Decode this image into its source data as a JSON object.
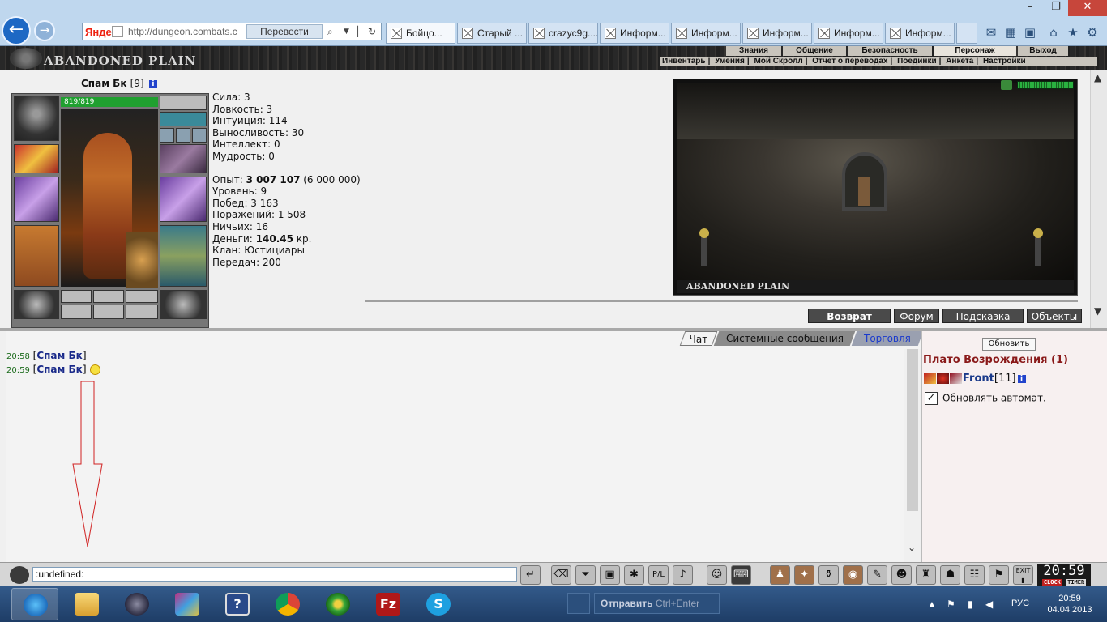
{
  "browser": {
    "search_engine": "Яндекс",
    "url": "http://dungeon.combats.c",
    "translate_label": "Перевести",
    "tabs": [
      {
        "label": "Бойцо..."
      },
      {
        "label": "Старый ..."
      },
      {
        "label": "crazyc9g...."
      },
      {
        "label": "Информ..."
      },
      {
        "label": "Информ..."
      },
      {
        "label": "Информ..."
      },
      {
        "label": "Информ..."
      },
      {
        "label": "Информ..."
      }
    ],
    "window_controls": {
      "minimize": "–",
      "restore": "❐",
      "close": "✕"
    }
  },
  "game": {
    "logo": "ABANDONED PLAIN",
    "top_menu": [
      "Знания",
      "Общение",
      "Безопасность",
      "Персонаж",
      "Выход"
    ],
    "sub_menu": [
      "Инвентарь",
      "Умения",
      "Мой Скролл",
      "Отчет о переводах",
      "Поединки",
      "Анкета",
      "Настройки"
    ]
  },
  "character": {
    "name": "Спам Бк",
    "level": "[9]",
    "hp": "819/819",
    "hp_fraction": 1.0,
    "stats": {
      "strength": "Сила: 3",
      "agility": "Ловкость: 3",
      "intuition": "Интуиция: 114",
      "endurance": "Выносливость: 30",
      "intellect": "Интеллект: 0",
      "wisdom": "Мудрость: 0"
    },
    "experience_label": "Опыт: ",
    "experience_value": "3 007 107",
    "experience_next": " (6 000 000)",
    "level_label": "Уровень: 9",
    "wins": "Побед: 3 163",
    "losses": "Поражений: 1 508",
    "draws": "Ничьих: 16",
    "money_label": "Деньги: ",
    "money_value": "140.45",
    "money_unit": " кр.",
    "clan": "Клан: Юстициары",
    "transfers": "Передач: 200"
  },
  "scene": {
    "title": "ABANDONED PLAIN",
    "buttons": [
      "Возврат",
      "Форум",
      "Подсказка",
      "Объекты"
    ]
  },
  "chat": {
    "tabs": [
      "Чат",
      "Системные сообщения",
      "Торговля"
    ],
    "messages": [
      {
        "time": "20:58",
        "nick": "Спам Бк",
        "has_smiley": false
      },
      {
        "time": "20:59",
        "nick": "Спам Бк",
        "has_smiley": true
      }
    ],
    "input_value": ":undefined:"
  },
  "location": {
    "refresh_label": "Обновить",
    "title": "Плато Возрождения (1)",
    "player_nick": "Front",
    "player_level": "[11]",
    "auto_refresh_label": "Обновлять автомат.",
    "auto_refresh_checked": true
  },
  "clock": {
    "time": "20:59",
    "label_clock": "CLOCK",
    "label_timer": "TIMER",
    "exit_label": "EXIT"
  },
  "taskbar": {
    "send_label": "Отправить",
    "send_shortcut": "Ctrl+Enter",
    "lang": "РУС",
    "time": "20:59",
    "date": "04.04.2013"
  },
  "colors": {
    "hp_green": "#20a030",
    "location_title": "#8a1a1a",
    "nick_blue": "#1a2a8a",
    "time_green": "#1a6a1a",
    "taskbar": "#1e3d66"
  }
}
